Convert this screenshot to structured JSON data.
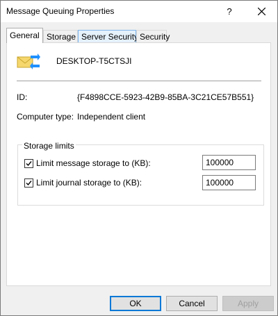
{
  "window": {
    "title": "Message Queuing Properties",
    "help_label": "?"
  },
  "tabs": [
    {
      "label": "General",
      "active": true
    },
    {
      "label": "Storage",
      "active": false
    },
    {
      "label": "Server Security",
      "active": false
    },
    {
      "label": "Security",
      "active": false
    }
  ],
  "general": {
    "computer_name": "DESKTOP-T5CTSJI",
    "id_label": "ID:",
    "id_value": "{F4898CCE-5923-42B9-85BA-3C21CE57B551}",
    "type_label": "Computer type:",
    "type_value": "Independent client",
    "storage_limits": {
      "legend": "Storage limits",
      "message": {
        "label": "Limit message storage to (KB):",
        "checked": true,
        "value": "100000"
      },
      "journal": {
        "label": "Limit journal storage to (KB):",
        "checked": true,
        "value": "100000"
      }
    }
  },
  "buttons": {
    "ok": "OK",
    "cancel": "Cancel",
    "apply": "Apply"
  },
  "icons": {
    "app": "message-queuing-icon",
    "close": "close-icon",
    "check": "checkmark-icon"
  },
  "colors": {
    "accent": "#0078d7",
    "tab_hover": "#e5f1fb",
    "envelope": "#f5d76e",
    "arrow": "#1e90ff"
  }
}
